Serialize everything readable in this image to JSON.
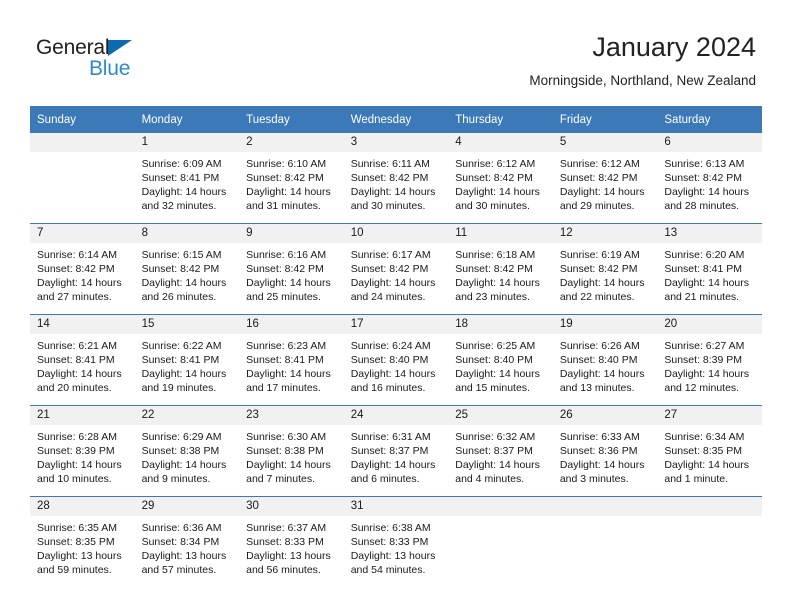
{
  "brand": {
    "name_part1": "General",
    "name_part2": "Blue",
    "triangle_icon": "triangle-icon",
    "accent_dark": "#0d6ab0",
    "accent_light": "#2e8bd0"
  },
  "header": {
    "title": "January 2024",
    "subtitle": "Morningside, Northland, New Zealand",
    "header_bg": "#3b79b8",
    "header_text": "#ffffff"
  },
  "calendar": {
    "weekday_headers": [
      "Sunday",
      "Monday",
      "Tuesday",
      "Wednesday",
      "Thursday",
      "Friday",
      "Saturday"
    ],
    "weeks": [
      [
        {
          "day": "",
          "sunrise": "",
          "sunset": "",
          "daylight_line1": "",
          "daylight_line2": "",
          "empty": true
        },
        {
          "day": "1",
          "sunrise": "Sunrise: 6:09 AM",
          "sunset": "Sunset: 8:41 PM",
          "daylight_line1": "Daylight: 14 hours",
          "daylight_line2": "and 32 minutes.",
          "empty": false
        },
        {
          "day": "2",
          "sunrise": "Sunrise: 6:10 AM",
          "sunset": "Sunset: 8:42 PM",
          "daylight_line1": "Daylight: 14 hours",
          "daylight_line2": "and 31 minutes.",
          "empty": false
        },
        {
          "day": "3",
          "sunrise": "Sunrise: 6:11 AM",
          "sunset": "Sunset: 8:42 PM",
          "daylight_line1": "Daylight: 14 hours",
          "daylight_line2": "and 30 minutes.",
          "empty": false
        },
        {
          "day": "4",
          "sunrise": "Sunrise: 6:12 AM",
          "sunset": "Sunset: 8:42 PM",
          "daylight_line1": "Daylight: 14 hours",
          "daylight_line2": "and 30 minutes.",
          "empty": false
        },
        {
          "day": "5",
          "sunrise": "Sunrise: 6:12 AM",
          "sunset": "Sunset: 8:42 PM",
          "daylight_line1": "Daylight: 14 hours",
          "daylight_line2": "and 29 minutes.",
          "empty": false
        },
        {
          "day": "6",
          "sunrise": "Sunrise: 6:13 AM",
          "sunset": "Sunset: 8:42 PM",
          "daylight_line1": "Daylight: 14 hours",
          "daylight_line2": "and 28 minutes.",
          "empty": false
        }
      ],
      [
        {
          "day": "7",
          "sunrise": "Sunrise: 6:14 AM",
          "sunset": "Sunset: 8:42 PM",
          "daylight_line1": "Daylight: 14 hours",
          "daylight_line2": "and 27 minutes.",
          "empty": false
        },
        {
          "day": "8",
          "sunrise": "Sunrise: 6:15 AM",
          "sunset": "Sunset: 8:42 PM",
          "daylight_line1": "Daylight: 14 hours",
          "daylight_line2": "and 26 minutes.",
          "empty": false
        },
        {
          "day": "9",
          "sunrise": "Sunrise: 6:16 AM",
          "sunset": "Sunset: 8:42 PM",
          "daylight_line1": "Daylight: 14 hours",
          "daylight_line2": "and 25 minutes.",
          "empty": false
        },
        {
          "day": "10",
          "sunrise": "Sunrise: 6:17 AM",
          "sunset": "Sunset: 8:42 PM",
          "daylight_line1": "Daylight: 14 hours",
          "daylight_line2": "and 24 minutes.",
          "empty": false
        },
        {
          "day": "11",
          "sunrise": "Sunrise: 6:18 AM",
          "sunset": "Sunset: 8:42 PM",
          "daylight_line1": "Daylight: 14 hours",
          "daylight_line2": "and 23 minutes.",
          "empty": false
        },
        {
          "day": "12",
          "sunrise": "Sunrise: 6:19 AM",
          "sunset": "Sunset: 8:42 PM",
          "daylight_line1": "Daylight: 14 hours",
          "daylight_line2": "and 22 minutes.",
          "empty": false
        },
        {
          "day": "13",
          "sunrise": "Sunrise: 6:20 AM",
          "sunset": "Sunset: 8:41 PM",
          "daylight_line1": "Daylight: 14 hours",
          "daylight_line2": "and 21 minutes.",
          "empty": false
        }
      ],
      [
        {
          "day": "14",
          "sunrise": "Sunrise: 6:21 AM",
          "sunset": "Sunset: 8:41 PM",
          "daylight_line1": "Daylight: 14 hours",
          "daylight_line2": "and 20 minutes.",
          "empty": false
        },
        {
          "day": "15",
          "sunrise": "Sunrise: 6:22 AM",
          "sunset": "Sunset: 8:41 PM",
          "daylight_line1": "Daylight: 14 hours",
          "daylight_line2": "and 19 minutes.",
          "empty": false
        },
        {
          "day": "16",
          "sunrise": "Sunrise: 6:23 AM",
          "sunset": "Sunset: 8:41 PM",
          "daylight_line1": "Daylight: 14 hours",
          "daylight_line2": "and 17 minutes.",
          "empty": false
        },
        {
          "day": "17",
          "sunrise": "Sunrise: 6:24 AM",
          "sunset": "Sunset: 8:40 PM",
          "daylight_line1": "Daylight: 14 hours",
          "daylight_line2": "and 16 minutes.",
          "empty": false
        },
        {
          "day": "18",
          "sunrise": "Sunrise: 6:25 AM",
          "sunset": "Sunset: 8:40 PM",
          "daylight_line1": "Daylight: 14 hours",
          "daylight_line2": "and 15 minutes.",
          "empty": false
        },
        {
          "day": "19",
          "sunrise": "Sunrise: 6:26 AM",
          "sunset": "Sunset: 8:40 PM",
          "daylight_line1": "Daylight: 14 hours",
          "daylight_line2": "and 13 minutes.",
          "empty": false
        },
        {
          "day": "20",
          "sunrise": "Sunrise: 6:27 AM",
          "sunset": "Sunset: 8:39 PM",
          "daylight_line1": "Daylight: 14 hours",
          "daylight_line2": "and 12 minutes.",
          "empty": false
        }
      ],
      [
        {
          "day": "21",
          "sunrise": "Sunrise: 6:28 AM",
          "sunset": "Sunset: 8:39 PM",
          "daylight_line1": "Daylight: 14 hours",
          "daylight_line2": "and 10 minutes.",
          "empty": false
        },
        {
          "day": "22",
          "sunrise": "Sunrise: 6:29 AM",
          "sunset": "Sunset: 8:38 PM",
          "daylight_line1": "Daylight: 14 hours",
          "daylight_line2": "and 9 minutes.",
          "empty": false
        },
        {
          "day": "23",
          "sunrise": "Sunrise: 6:30 AM",
          "sunset": "Sunset: 8:38 PM",
          "daylight_line1": "Daylight: 14 hours",
          "daylight_line2": "and 7 minutes.",
          "empty": false
        },
        {
          "day": "24",
          "sunrise": "Sunrise: 6:31 AM",
          "sunset": "Sunset: 8:37 PM",
          "daylight_line1": "Daylight: 14 hours",
          "daylight_line2": "and 6 minutes.",
          "empty": false
        },
        {
          "day": "25",
          "sunrise": "Sunrise: 6:32 AM",
          "sunset": "Sunset: 8:37 PM",
          "daylight_line1": "Daylight: 14 hours",
          "daylight_line2": "and 4 minutes.",
          "empty": false
        },
        {
          "day": "26",
          "sunrise": "Sunrise: 6:33 AM",
          "sunset": "Sunset: 8:36 PM",
          "daylight_line1": "Daylight: 14 hours",
          "daylight_line2": "and 3 minutes.",
          "empty": false
        },
        {
          "day": "27",
          "sunrise": "Sunrise: 6:34 AM",
          "sunset": "Sunset: 8:35 PM",
          "daylight_line1": "Daylight: 14 hours",
          "daylight_line2": "and 1 minute.",
          "empty": false
        }
      ],
      [
        {
          "day": "28",
          "sunrise": "Sunrise: 6:35 AM",
          "sunset": "Sunset: 8:35 PM",
          "daylight_line1": "Daylight: 13 hours",
          "daylight_line2": "and 59 minutes.",
          "empty": false
        },
        {
          "day": "29",
          "sunrise": "Sunrise: 6:36 AM",
          "sunset": "Sunset: 8:34 PM",
          "daylight_line1": "Daylight: 13 hours",
          "daylight_line2": "and 57 minutes.",
          "empty": false
        },
        {
          "day": "30",
          "sunrise": "Sunrise: 6:37 AM",
          "sunset": "Sunset: 8:33 PM",
          "daylight_line1": "Daylight: 13 hours",
          "daylight_line2": "and 56 minutes.",
          "empty": false
        },
        {
          "day": "31",
          "sunrise": "Sunrise: 6:38 AM",
          "sunset": "Sunset: 8:33 PM",
          "daylight_line1": "Daylight: 13 hours",
          "daylight_line2": "and 54 minutes.",
          "empty": false
        },
        {
          "day": "",
          "sunrise": "",
          "sunset": "",
          "daylight_line1": "",
          "daylight_line2": "",
          "empty": true
        },
        {
          "day": "",
          "sunrise": "",
          "sunset": "",
          "daylight_line1": "",
          "daylight_line2": "",
          "empty": true
        },
        {
          "day": "",
          "sunrise": "",
          "sunset": "",
          "daylight_line1": "",
          "daylight_line2": "",
          "empty": true
        }
      ]
    ]
  }
}
